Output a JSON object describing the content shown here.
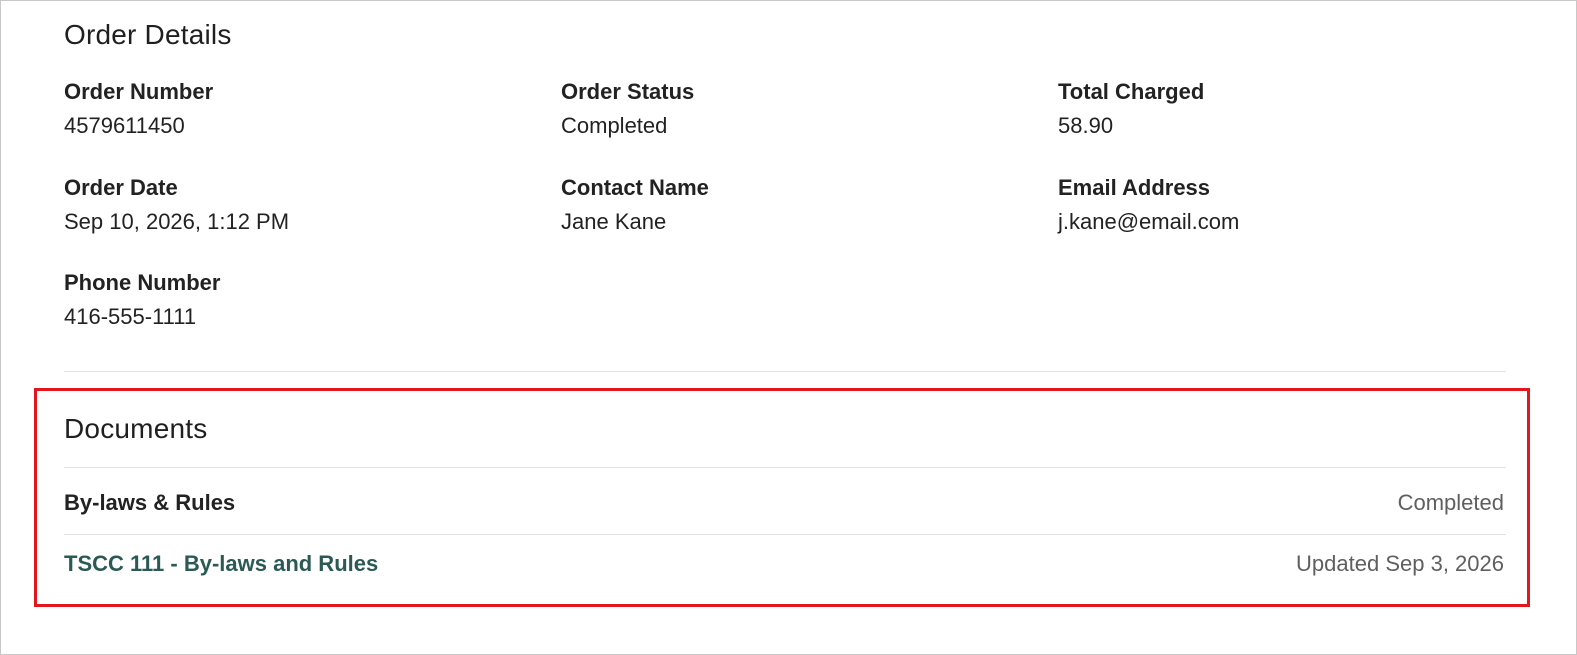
{
  "order_details": {
    "title": "Order Details",
    "fields": {
      "order_number": {
        "label": "Order Number",
        "value": "4579611450"
      },
      "order_status": {
        "label": "Order Status",
        "value": "Completed"
      },
      "total_charged": {
        "label": "Total Charged",
        "value": "58.90"
      },
      "order_date": {
        "label": "Order Date",
        "value": "Sep 10, 2026, 1:12 PM"
      },
      "contact_name": {
        "label": "Contact Name",
        "value": "Jane Kane"
      },
      "email_address": {
        "label": "Email Address",
        "value": "j.kane@email.com"
      },
      "phone_number": {
        "label": "Phone Number",
        "value": "416-555-1111"
      }
    }
  },
  "documents": {
    "title": "Documents",
    "group": {
      "name": "By-laws & Rules",
      "status": "Completed"
    },
    "items": [
      {
        "name": "TSCC 111 - By-laws and Rules",
        "updated": "Updated Sep 3, 2026"
      }
    ]
  },
  "colors": {
    "highlight": "#e3161d",
    "link": "#2b5a54",
    "muted_text": "#5f5f5f"
  }
}
